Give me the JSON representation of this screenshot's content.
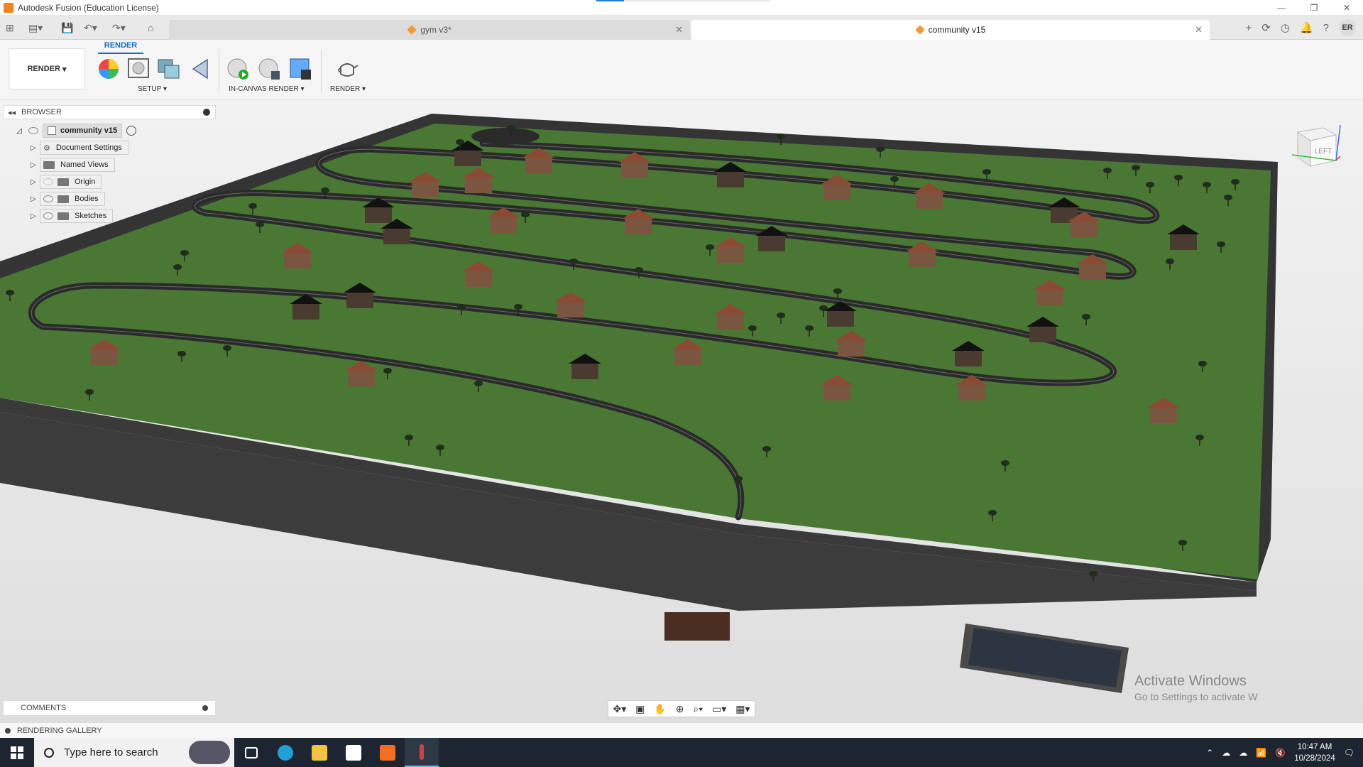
{
  "window": {
    "title": "Autodesk Fusion (Education License)",
    "progress": 0.16,
    "controls": [
      "—",
      "❐",
      "✕"
    ]
  },
  "tabs": [
    {
      "label": "gym v3*",
      "active": false
    },
    {
      "label": "community v15",
      "active": true
    }
  ],
  "user": {
    "initials": "ER"
  },
  "toolbar": {
    "workspace": "RENDER",
    "ribbon_tab": "RENDER",
    "groups": [
      {
        "label": "SETUP"
      },
      {
        "label": "IN-CANVAS RENDER"
      },
      {
        "label": "RENDER"
      }
    ]
  },
  "browser": {
    "title": "BROWSER",
    "root": "community v15",
    "items": [
      {
        "label": "Document Settings",
        "icon": "gear-icon"
      },
      {
        "label": "Named Views",
        "icon": "folder-icon"
      },
      {
        "label": "Origin",
        "icon": "folder-icon"
      },
      {
        "label": "Bodies",
        "icon": "folder-icon"
      },
      {
        "label": "Sketches",
        "icon": "folder-icon"
      }
    ]
  },
  "viewcube": {
    "face": "LEFT"
  },
  "comments": {
    "label": "COMMENTS"
  },
  "gallery": {
    "label": "RENDERING GALLERY"
  },
  "watermark": {
    "line1": "Activate Windows",
    "line2": "Go to Settings to activate W"
  },
  "taskbar": {
    "search_placeholder": "Type here to search",
    "time": "10:47 AM",
    "date": "10/28/2024"
  },
  "colors": {
    "grass": "#4b7a35",
    "wall": "#3a3a3a",
    "road": "#2b2b2b",
    "accent": "#0f6ecd"
  }
}
